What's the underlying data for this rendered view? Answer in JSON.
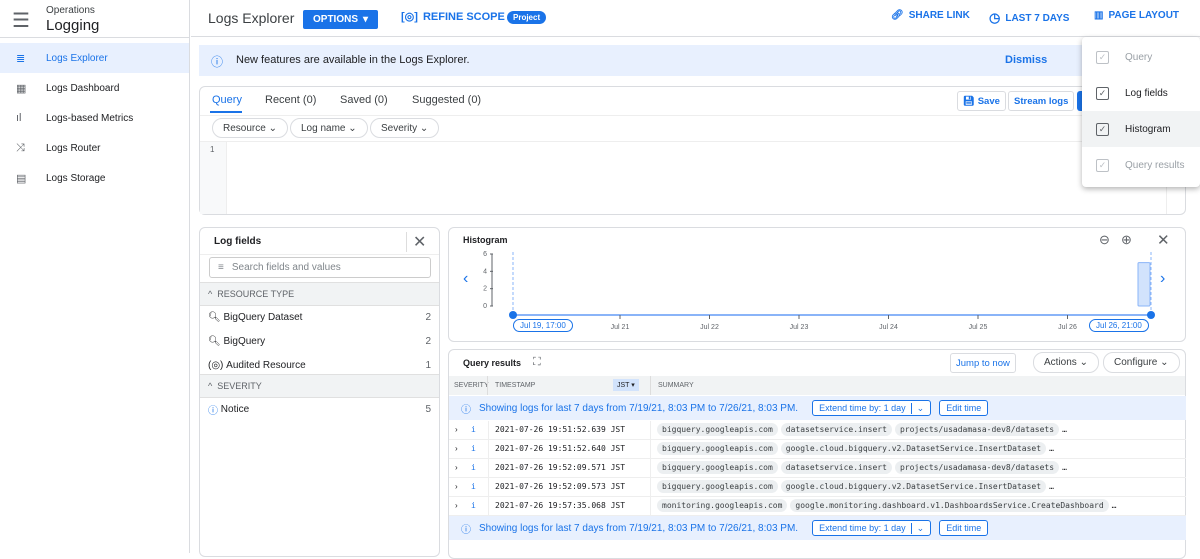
{
  "app": {
    "product": "Operations",
    "title": "Logging"
  },
  "sidebar": {
    "items": [
      {
        "label": "Logs Explorer",
        "icon": "list-icon",
        "active": true
      },
      {
        "label": "Logs Dashboard",
        "icon": "dashboard-icon"
      },
      {
        "label": "Logs-based Metrics",
        "icon": "bar-chart-icon"
      },
      {
        "label": "Logs Router",
        "icon": "shuffle-icon"
      },
      {
        "label": "Logs Storage",
        "icon": "storage-icon"
      }
    ]
  },
  "header": {
    "page_title": "Logs Explorer",
    "options": "OPTIONS",
    "refine_scope": "REFINE SCOPE",
    "scope_badge": "Project",
    "share_link": "SHARE LINK",
    "time_range": "LAST 7 DAYS",
    "page_layout": "PAGE LAYOUT"
  },
  "banner": {
    "text": "New features are available in the Logs Explorer.",
    "dismiss": "Dismiss"
  },
  "query": {
    "tabs": [
      "Query",
      "Recent (0)",
      "Saved (0)",
      "Suggested (0)"
    ],
    "save": "Save",
    "stream": "Stream logs",
    "filters": [
      "Resource",
      "Log name",
      "Severity"
    ],
    "line_number": "1"
  },
  "layout_menu": {
    "items": [
      {
        "label": "Query",
        "checked": true,
        "disabled": true
      },
      {
        "label": "Log fields",
        "checked": true
      },
      {
        "label": "Histogram",
        "checked": true,
        "hovered": true
      },
      {
        "label": "Query results",
        "checked": true,
        "disabled": true
      }
    ]
  },
  "log_fields": {
    "title": "Log fields",
    "search_placeholder": "Search fields and values",
    "sections": [
      {
        "title": "RESOURCE TYPE",
        "items": [
          {
            "label": "BigQuery Dataset",
            "count": "2"
          },
          {
            "label": "BigQuery",
            "count": "2"
          },
          {
            "label": "Audited Resource",
            "count": "1"
          }
        ]
      },
      {
        "title": "SEVERITY",
        "items": [
          {
            "label": "Notice",
            "count": "5"
          }
        ]
      }
    ]
  },
  "chart_data": {
    "type": "bar",
    "title": "Histogram",
    "x_ticks": [
      "Jul 21",
      "Jul 22",
      "Jul 23",
      "Jul 24",
      "Jul 25",
      "Jul 26"
    ],
    "y_ticks": [
      "0",
      "2",
      "4",
      "6"
    ],
    "ylim": [
      0,
      6
    ],
    "range_start": "Jul 19, 17:00",
    "range_end": "Jul 26, 21:00",
    "bars": [
      {
        "x": "Jul 26, 20:00",
        "value": 5
      }
    ],
    "accent": "#1a73e8"
  },
  "results": {
    "title": "Query results",
    "jump": "Jump to now",
    "actions": "Actions",
    "configure": "Configure",
    "columns": {
      "severity": "SEVERITY",
      "timestamp": "TIMESTAMP",
      "tz": "JST",
      "summary": "SUMMARY"
    },
    "info": "Showing logs for last 7 days from 7/19/21, 8:03 PM to 7/26/21, 8:03 PM.",
    "extend": "Extend time by: 1 day",
    "edit": "Edit time",
    "rows": [
      {
        "ts": "2021-07-26 19:51:52.639 JST",
        "pills": [
          "bigquery.googleapis.com",
          "datasetservice.insert",
          "projects/usadamasa-dev8/datasets"
        ]
      },
      {
        "ts": "2021-07-26 19:51:52.640 JST",
        "pills": [
          "bigquery.googleapis.com",
          "google.cloud.bigquery.v2.DatasetService.InsertDataset"
        ]
      },
      {
        "ts": "2021-07-26 19:52:09.571 JST",
        "pills": [
          "bigquery.googleapis.com",
          "datasetservice.insert",
          "projects/usadamasa-dev8/datasets"
        ]
      },
      {
        "ts": "2021-07-26 19:52:09.573 JST",
        "pills": [
          "bigquery.googleapis.com",
          "google.cloud.bigquery.v2.DatasetService.InsertDataset"
        ]
      },
      {
        "ts": "2021-07-26 19:57:35.068 JST",
        "pills": [
          "monitoring.googleapis.com",
          "google.monitoring.dashboard.v1.DashboardsService.CreateDashboard"
        ]
      }
    ]
  }
}
